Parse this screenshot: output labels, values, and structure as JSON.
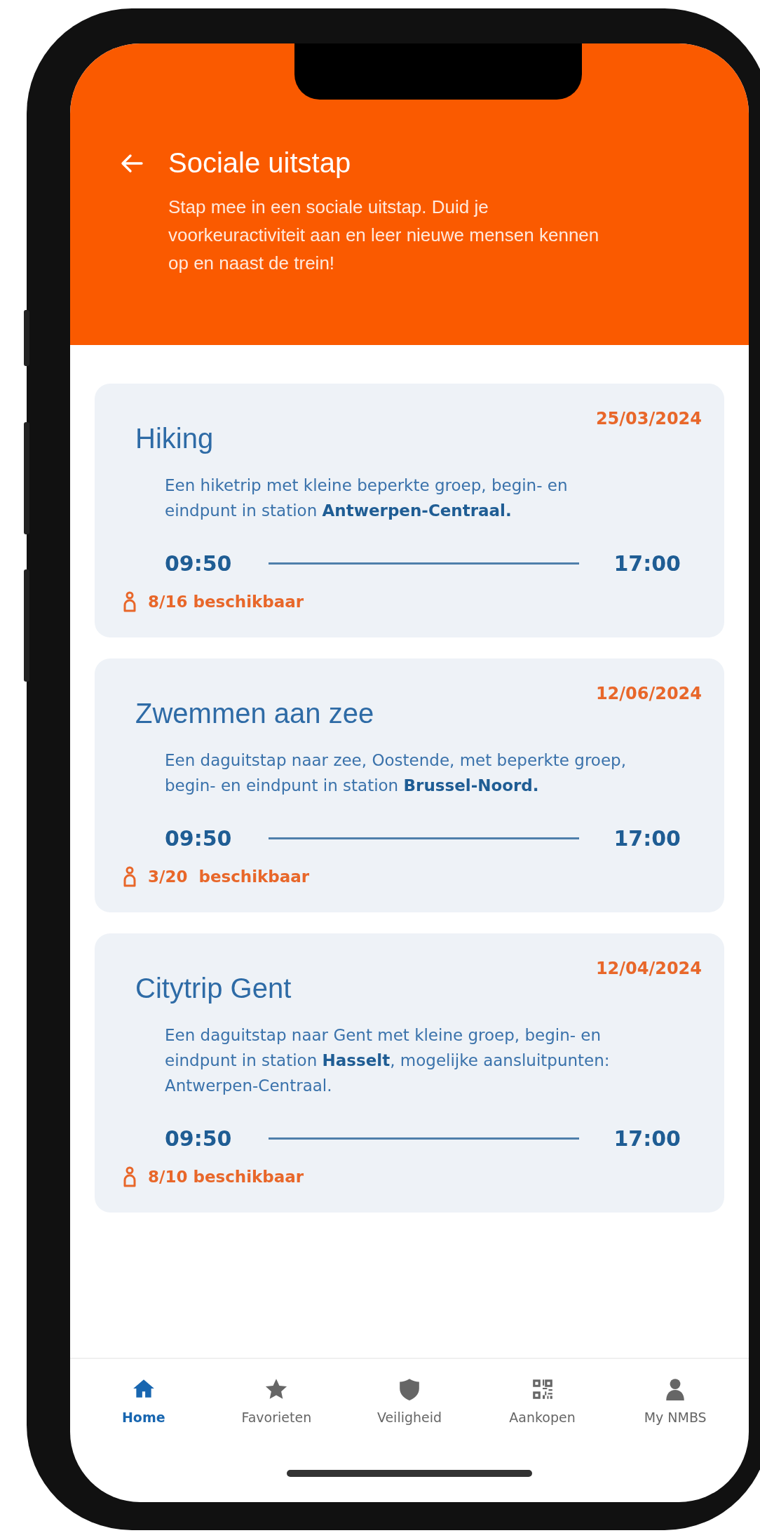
{
  "header": {
    "title": "Sociale uitstap",
    "description": "Stap mee in een sociale uitstap. Duid je voorkeuractiviteit aan en leer nieuwe mensen kennen op en naast de trein!"
  },
  "trips": [
    {
      "title": "Hiking",
      "date": "25/03/2024",
      "description": "Een hiketrip met kleine beperkte groep, begin- en eindpunt in station **Antwerpen-Centraal.**",
      "start": "09:50",
      "end": "17:00",
      "availability": "8/16 beschikbaar"
    },
    {
      "title": "Zwemmen aan zee",
      "date": "12/06/2024",
      "description": "Een daguitstap naar zee, Oostende, met beperkte groep, begin- en eindpunt in station **Brussel-Noord.**",
      "start": "09:50",
      "end": "17:00",
      "availability": "3/20  beschikbaar"
    },
    {
      "title": "Citytrip Gent",
      "date": "12/04/2024",
      "description": "Een daguitstap naar Gent met kleine groep, begin- en eindpunt in station **Hasselt**, mogelijke aansluitpunten: Antwerpen-Centraal.",
      "start": "09:50",
      "end": "17:00",
      "availability": "8/10 beschikbaar"
    }
  ],
  "nav": [
    {
      "label": "Home",
      "kind": "home",
      "selected": true
    },
    {
      "label": "Favorieten",
      "kind": "star",
      "selected": false
    },
    {
      "label": "Veiligheid",
      "kind": "shield",
      "selected": false
    },
    {
      "label": "Aankopen",
      "kind": "qr",
      "selected": false
    },
    {
      "label": "My NMBS",
      "kind": "person",
      "selected": false
    }
  ]
}
